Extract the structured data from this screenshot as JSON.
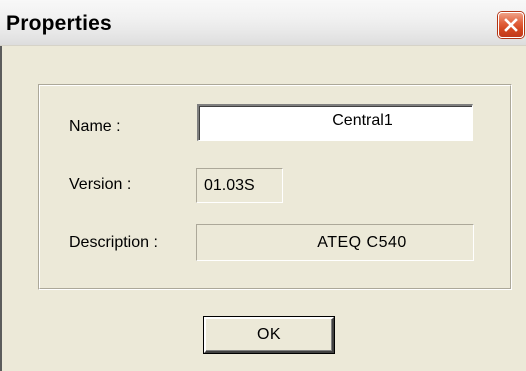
{
  "window": {
    "title": "Properties",
    "close_icon": "close-icon",
    "close_color": "#d2461f"
  },
  "form": {
    "name_label": "Name :",
    "name_value": "Central1",
    "version_label": "Version :",
    "version_value": "01.03S",
    "description_label": "Description :",
    "description_value": "ATEQ C540"
  },
  "buttons": {
    "ok_label": "OK"
  }
}
